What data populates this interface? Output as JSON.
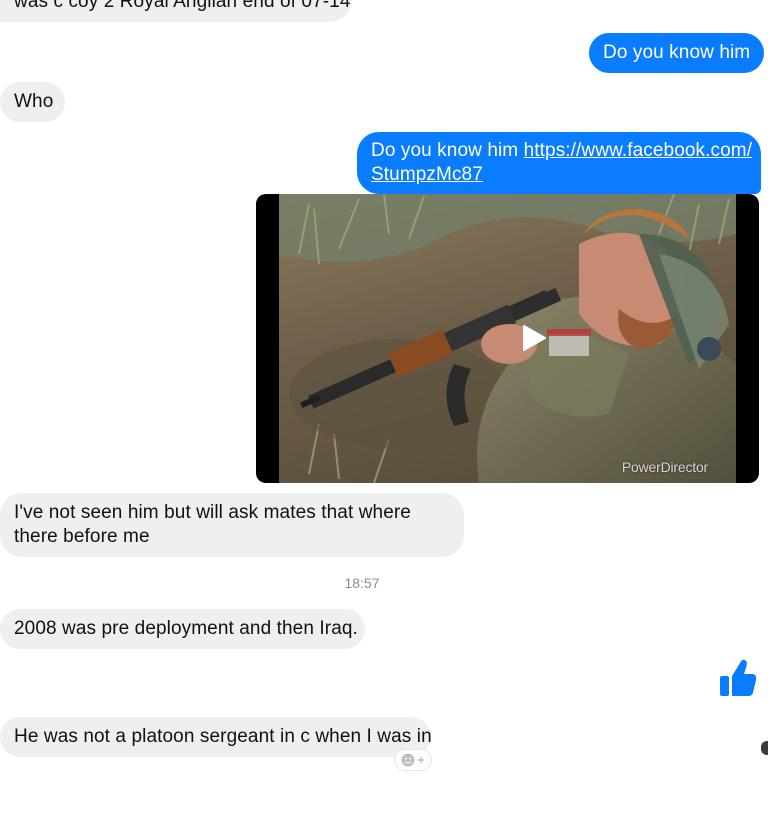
{
  "conversation": {
    "messages": [
      {
        "direction": "incoming",
        "text": "was c coy 2 Royal Anglian end of 07-14"
      },
      {
        "direction": "outgoing",
        "text": "Do you know him"
      },
      {
        "direction": "incoming",
        "text": "Who"
      },
      {
        "direction": "outgoing",
        "text_prefix": "Do you know him ",
        "link_line1": "https://www.facebook.com/",
        "link_line2": "StumpzMc87"
      },
      {
        "direction": "incoming",
        "text": "I've not seen him but will ask mates that where there before me"
      },
      {
        "direction": "incoming",
        "text": "2008 was pre deployment and then Iraq."
      },
      {
        "direction": "incoming",
        "text": "He was not a platoon sergeant in c when I was in"
      }
    ],
    "video": {
      "watermark": "PowerDirector",
      "play_icon": "play-icon"
    },
    "timestamp": "18:57",
    "like_icon": "thumbs-up-icon",
    "add_reaction_icon": "add-reaction-icon"
  },
  "colors": {
    "outgoing_bubble": "#0a7cff",
    "incoming_bubble": "#efeff0",
    "like": "#0a7cff",
    "timestamp": "#8a8d91"
  }
}
